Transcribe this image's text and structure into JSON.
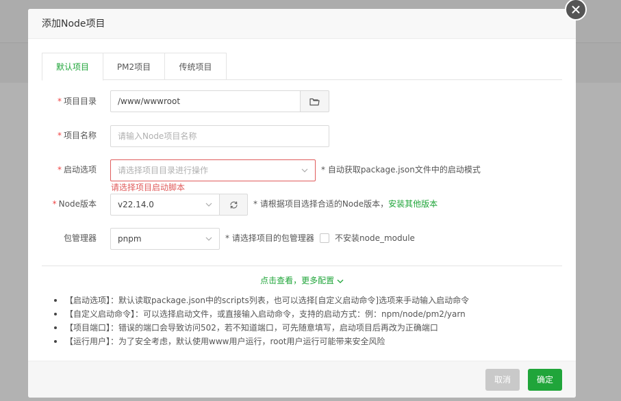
{
  "dialog": {
    "title": "添加Node项目",
    "close_icon": "close-icon"
  },
  "tabs": [
    {
      "label": "默认项目",
      "active": true
    },
    {
      "label": "PM2项目",
      "active": false
    },
    {
      "label": "传统项目",
      "active": false
    }
  ],
  "form": {
    "project_dir": {
      "label": "项目目录",
      "required": true,
      "value": "/www/wwwroot",
      "icon": "folder-icon"
    },
    "project_name": {
      "label": "项目名称",
      "required": true,
      "placeholder": "请输入Node项目名称"
    },
    "start_option": {
      "label": "启动选项",
      "required": true,
      "placeholder": "请选择项目目录进行操作",
      "hint": "* 自动获取package.json文件中的启动模式",
      "error": "请选择项目启动脚本"
    },
    "node_version": {
      "label": "Node版本",
      "required": true,
      "value": "v22.14.0",
      "hint": "* 请根据项目选择合适的Node版本，",
      "link": "安装其他版本",
      "refresh_icon": "refresh-icon"
    },
    "package_manager": {
      "label": "包管理器",
      "required": false,
      "value": "pnpm",
      "hint": "* 请选择项目的包管理器",
      "checkbox_label": "不安装node_module",
      "checked": false
    }
  },
  "more_config": "点击查看，更多配置",
  "notes": [
    "【启动选项】：默认读取package.json中的scripts列表，也可以选择[自定义启动命令]选项来手动输入启动命令",
    "【自定义启动命令】：可以选择启动文件，或直接输入启动命令，支持的启动方式：例：npm/node/pm2/yarn",
    "【项目端口】：错误的端口会导致访问502，若不知道端口，可先随意填写，启动项目后再改为正确端口",
    "【运行用户】：为了安全考虑，默认使用www用户运行，root用户运行可能带来安全风险"
  ],
  "footer": {
    "cancel": "取消",
    "confirm": "确定"
  },
  "colors": {
    "accent": "#20a53a",
    "error": "#e05b5b",
    "required": "#ef4444"
  }
}
